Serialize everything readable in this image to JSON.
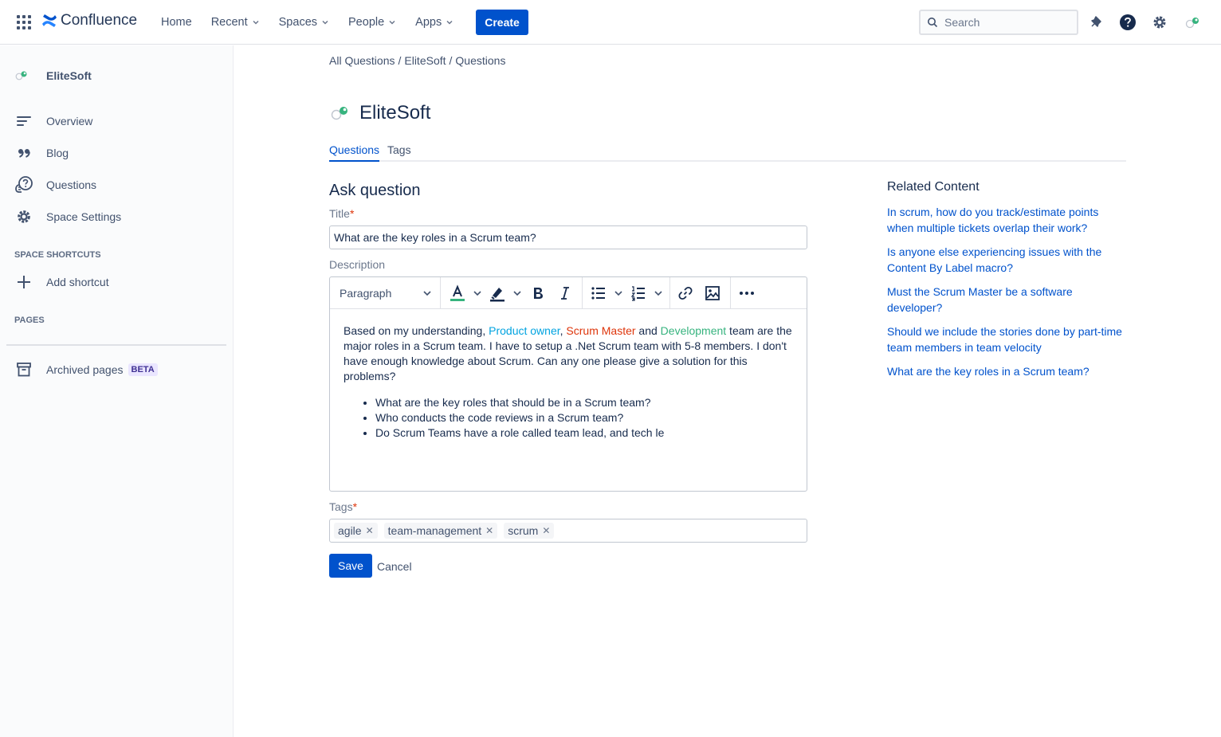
{
  "topnav": {
    "product": "Confluence",
    "items": [
      {
        "label": "Home",
        "dropdown": false
      },
      {
        "label": "Recent",
        "dropdown": true
      },
      {
        "label": "Spaces",
        "dropdown": true
      },
      {
        "label": "People",
        "dropdown": true
      },
      {
        "label": "Apps",
        "dropdown": true
      }
    ],
    "create_label": "Create",
    "search_placeholder": "Search"
  },
  "sidebar": {
    "space_name": "EliteSoft",
    "items": [
      {
        "label": "Overview",
        "icon": "overview-icon"
      },
      {
        "label": "Blog",
        "icon": "quote-icon"
      },
      {
        "label": "Questions",
        "icon": "questions-icon"
      },
      {
        "label": "Space Settings",
        "icon": "gear-icon"
      }
    ],
    "shortcuts_heading": "SPACE SHORTCUTS",
    "add_shortcut": "Add shortcut",
    "pages_heading": "PAGES",
    "archived": "Archived pages",
    "beta": "BETA"
  },
  "breadcrumb": [
    "All Questions",
    "EliteSoft",
    "Questions"
  ],
  "page": {
    "title": "EliteSoft",
    "tabs": [
      "Questions",
      "Tags"
    ]
  },
  "form": {
    "heading": "Ask question",
    "title_label": "Title",
    "title_value": "What are the key roles in a Scrum team?",
    "description_label": "Description",
    "paragraph_style": "Paragraph",
    "desc_intro": "Based on my understanding, ",
    "desc_role1": "Product owner",
    "desc_comma": ", ",
    "desc_role2": "Scrum Master",
    "desc_and": " and ",
    "desc_role3": "Development",
    "desc_rest": " team are the major roles in a Scrum team. I have to setup a .Net Scrum team with 5-8 members. I don't have enough knowledge about Scrum. Can any one please give a solution for this problems?",
    "desc_bullets": [
      "What are the key roles that should be in a Scrum team?",
      "Who conducts the code reviews in a Scrum team?",
      "Do Scrum Teams have a role called team lead, and tech le"
    ],
    "tags_label": "Tags",
    "tags": [
      "agile",
      "team-management",
      "scrum"
    ],
    "save": "Save",
    "cancel": "Cancel"
  },
  "related": {
    "title": "Related Content",
    "links": [
      "In scrum, how do you track/estimate points when multiple tickets overlap their work?",
      "Is anyone else experiencing issues with the Content By Label macro?",
      "Must the Scrum Master be a software developer?",
      "Should we include the stories done by part-time team members in team velocity",
      "What are the key roles in a Scrum team?"
    ]
  },
  "colors": {
    "brand": "#0052cc",
    "role1": "#00a3e0",
    "role2": "#de350b",
    "role3": "#36b37e"
  }
}
